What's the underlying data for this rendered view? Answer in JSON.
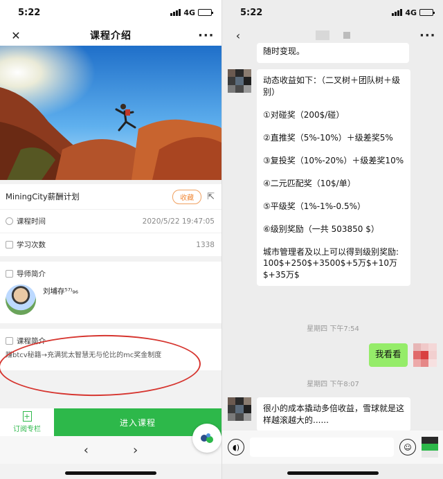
{
  "left": {
    "status": {
      "time": "5:22",
      "network": "4G"
    },
    "nav": {
      "title": "课程介绍",
      "close_icon": "close-icon",
      "more_icon": "more-icon"
    },
    "course": {
      "title": "MiningCity薪酬计划",
      "favorite_label": "收藏",
      "time_label": "课程时间",
      "time_value": "2020/5/22 19:47:05",
      "count_label": "学习次数",
      "count_value": "1338"
    },
    "teacher": {
      "section": "导师简介",
      "name": "刘埔存⁵⁷⁾₉₆"
    },
    "intro": {
      "section": "课程简介",
      "text": "赚btcv秘籍→充满犹太智慧无与伦比的mc奖金制度"
    },
    "bottom": {
      "subscribe_label": "订阅专栏",
      "enter_label": "进入课程"
    },
    "colors": {
      "accent": "#2db84a",
      "favorite": "#f08a3a",
      "annotation": "#d6352f"
    }
  },
  "right": {
    "status": {
      "time": "5:22",
      "network": "4G"
    },
    "messages": [
      {
        "text": "随时变现。"
      },
      {
        "text": "动态收益如下：（二叉树＋团队树＋级别）\n\n①对碰奖（200$/碰）\n\n②直推奖（5%-10%）＋级差奖5%\n\n③复投奖（10%-20%）＋级差奖10%\n\n④二元匹配奖（10$/单）\n\n⑤平级奖（1%-1%-0.5%）\n\n⑥级别奖励（一共 503850 $）\n\n城市管理者及以上可以得到级别奖励:\n100$+250$+3500$+5万$+10万$+35万$"
      },
      {
        "text": "我看看"
      },
      {
        "text": "很小的成本撬动多倍收益，雪球就是这样越滚越大的......"
      }
    ],
    "times": [
      "星期四 下午7:54",
      "星期四 下午8:07"
    ],
    "colors": {
      "bubble_self": "#95ec69",
      "bubble_other": "#ffffff"
    }
  }
}
